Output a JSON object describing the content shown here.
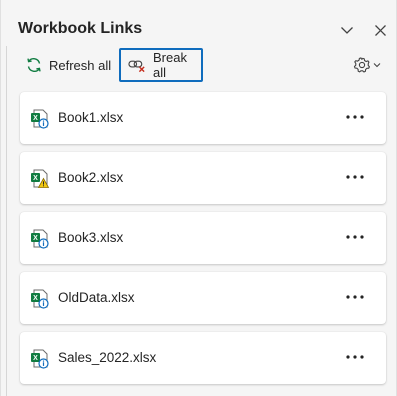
{
  "pane": {
    "title": "Workbook Links",
    "collapse_icon": "chevron-down-icon",
    "close_icon": "close-icon"
  },
  "toolbar": {
    "refresh_label": "Refresh all",
    "refresh_icon": "refresh-icon",
    "break_label": "Break all",
    "break_icon": "break-link-icon",
    "settings_icon": "gear-icon"
  },
  "links": [
    {
      "name": "Book1.xlsx",
      "status": "info",
      "status_icon": "info-icon"
    },
    {
      "name": "Book2.xlsx",
      "status": "warning",
      "status_icon": "warning-icon"
    },
    {
      "name": "Book3.xlsx",
      "status": "info",
      "status_icon": "info-icon"
    },
    {
      "name": "OldData.xlsx",
      "status": "info",
      "status_icon": "info-icon"
    },
    {
      "name": "Sales_2022.xlsx",
      "status": "info",
      "status_icon": "info-icon"
    }
  ],
  "colors": {
    "excel_green": "#107c41",
    "info_blue": "#0f6cbd",
    "warning_yellow": "#f2c811",
    "focus_border": "#0f6cbd",
    "break_red": "#c42b1c"
  }
}
